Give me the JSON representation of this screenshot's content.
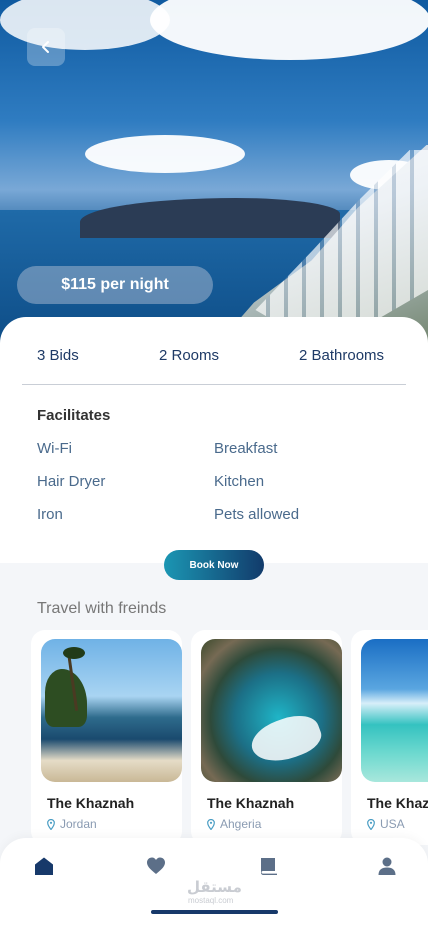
{
  "hero": {
    "price_label": "$115 per night"
  },
  "stats": {
    "bids": "3 Bids",
    "rooms": "2 Rooms",
    "bathrooms": "2 Bathrooms"
  },
  "facilities": {
    "title": "Facilitates",
    "items": [
      "Wi-Fi",
      "Breakfast",
      "Hair Dryer",
      "Kitchen",
      "Iron",
      "Pets allowed"
    ]
  },
  "actions": {
    "book_label": "Book Now"
  },
  "travel": {
    "title": "Travel with freinds",
    "cards": [
      {
        "name": "The Khaznah",
        "location": "Jordan"
      },
      {
        "name": "The Khaznah",
        "location": "Ahgeria"
      },
      {
        "name": "The Khaznah",
        "location": "USA"
      }
    ]
  },
  "nav": {
    "items": [
      "home-icon",
      "heart-icon",
      "book-icon",
      "profile-icon"
    ],
    "active_color": "#17396a",
    "inactive_color": "#5c6f88"
  },
  "watermark": {
    "text": "مستقل",
    "sub": "mostaql.com"
  },
  "colors": {
    "primary": "#1e3a66",
    "accent": "#1b96b3"
  }
}
